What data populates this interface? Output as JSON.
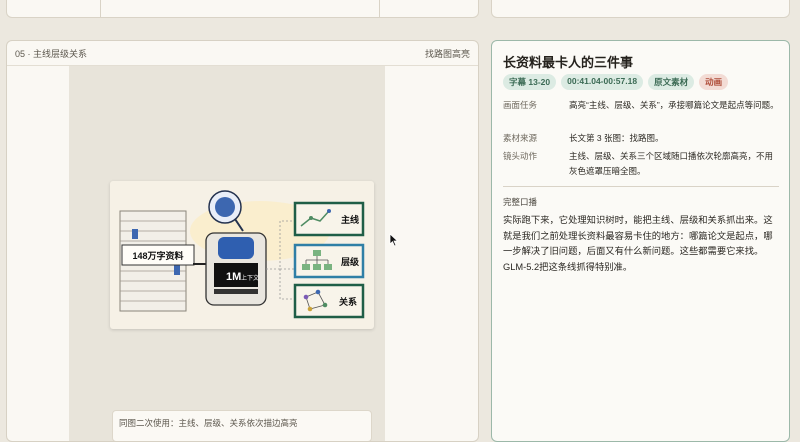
{
  "left_panel": {
    "title": "05 · 主线层级关系",
    "action": "找路图高亮",
    "illustration": {
      "stack_label": "148万字资料",
      "chip_label": "1M",
      "chip_sub": "上下文",
      "cards": [
        "主线",
        "层级",
        "关系"
      ]
    },
    "caption": "同图二次使用：主线、层级、关系依次描边高亮"
  },
  "right_panel": {
    "title": "长资料最卡人的三件事",
    "tags": [
      {
        "label": "字幕 13-20",
        "color": "#3c6b55"
      },
      {
        "label": "00:41.04-00:57.18",
        "color": "#3c6b55"
      },
      {
        "label": "原文素材",
        "color": "#3c6b55"
      },
      {
        "label": "动画",
        "color": "#b04e3a"
      }
    ],
    "fields": [
      {
        "key": "画面任务",
        "value": "高亮“主线、层级、关系”，承接哪篇论文是起点等问题。"
      },
      {
        "key": "素材来源",
        "value": "长文第 3 张图：找路图。"
      },
      {
        "key": "镜头动作",
        "value": "主线、层级、关系三个区域随口播依次轮廓高亮，不用灰色遮罩压暗全图。"
      }
    ],
    "narration_label": "完整口播",
    "narration": "实际跑下来，它处理知识树时，能把主线、层级和关系抓出来。这就是我们之前处理长资料最容易卡住的地方：哪篇论文是起点，哪一步解决了旧问题，后面又有什么新问题。这些都需要它来找。GLM-5.2把这条线抓得特别准。"
  }
}
